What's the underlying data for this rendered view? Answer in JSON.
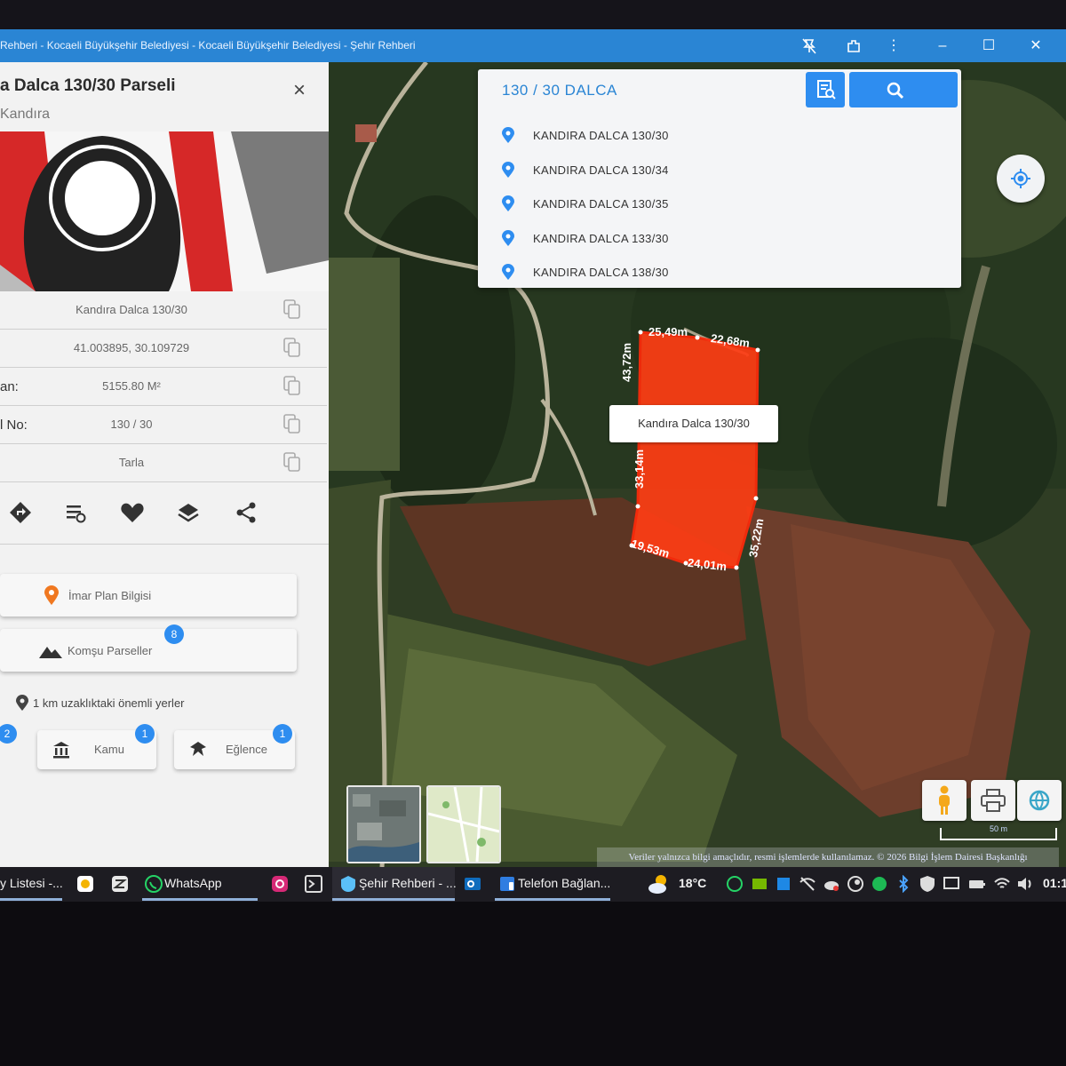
{
  "window": {
    "title": "Rehberi - Kocaeli Büyükşehir Belediyesi - Kocaeli Büyükşehir Belediyesi - Şehir Rehberi"
  },
  "panel": {
    "title": "a Dalca 130/30 Parseli",
    "subtitle": "Kandıra",
    "close_label": "×",
    "rows": [
      {
        "label": "",
        "value": "Kandıra Dalca 130/30"
      },
      {
        "label": "",
        "value": "41.003895, 30.109729"
      },
      {
        "label": "an:",
        "value": "5155.80 M²"
      },
      {
        "label": "l No:",
        "value": "130 / 30"
      },
      {
        "label": "",
        "value": "Tarla"
      }
    ],
    "actions": [
      "directions-icon",
      "list-settings-icon",
      "heart-icon",
      "layers-icon",
      "share-icon"
    ],
    "imar_label": "İmar Plan Bilgisi",
    "komsu_label": "Komşu Parseller",
    "komsu_badge": "8",
    "nearby_title": "1 km uzaklıktaki önemli yerler",
    "nearby": [
      {
        "label": "",
        "badge": "2"
      },
      {
        "label": "Kamu",
        "badge": "1"
      },
      {
        "label": "Eğlence",
        "badge": "1"
      }
    ]
  },
  "search": {
    "query": "130 / 30 DALCA",
    "results": [
      "KANDIRA DALCA 130/30",
      "KANDIRA DALCA 130/34",
      "KANDIRA DALCA 130/35",
      "KANDIRA DALCA 133/30",
      "KANDIRA DALCA 138/30"
    ]
  },
  "map": {
    "tooltip": "Kandıra Dalca 130/30",
    "measures": [
      "25,49m",
      "22,68m",
      "43,72m",
      "33,14m",
      "35,22m",
      "19,53m",
      "24,01m"
    ],
    "copyright": "Veriler yalnızca bilgi amaçlıdır, resmi işlemlerde kullanılamaz. © 2026 Bilgi İşlem Dairesi Başkanlığı",
    "scale": "50 m",
    "parcel_color": "#ff3d14"
  },
  "taskbar": {
    "items": [
      "y Listesi -...",
      "WhatsApp",
      "Şehir Rehberi - ...",
      "Telefon Bağlan..."
    ],
    "temperature": "18°C",
    "clock": "01:1"
  },
  "colors": {
    "accent": "#2e8df0",
    "titlebar": "#2a85d4"
  }
}
